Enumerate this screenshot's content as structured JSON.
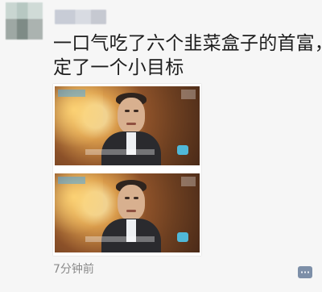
{
  "post": {
    "text_line_1": "一口气吃了六个韭菜盒子的首富，",
    "text_line_2": "定了一个小目标",
    "timestamp": "7分钟前"
  }
}
